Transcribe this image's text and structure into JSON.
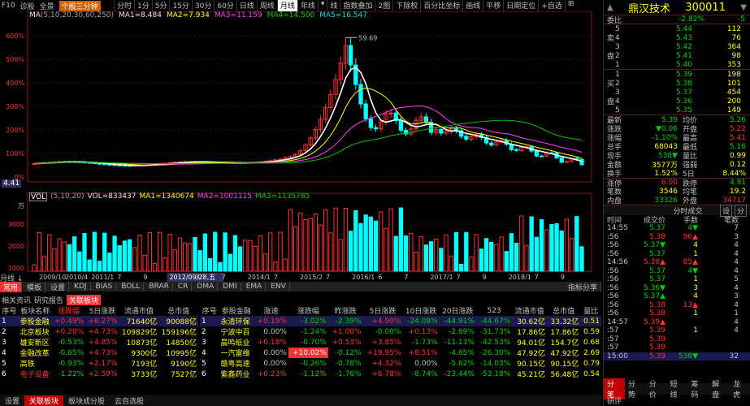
{
  "topbar": {
    "items": [
      "F10",
      "诊股",
      "全景",
      "个股三分钟"
    ],
    "active": "个股三分钟"
  },
  "toolbar": {
    "items": [
      "分时",
      "1分",
      "5分",
      "15分",
      "30分",
      "60分",
      "日线",
      "周线",
      "月线",
      "年线",
      "▾",
      "线",
      "指数叠加",
      "2图",
      "下除权",
      "百分比坐标",
      "画线",
      "平移",
      "日期定位",
      "+自选",
      "⊞"
    ],
    "active": "月线"
  },
  "ma_line": {
    "label": "MA",
    "params": "(5,10,20,30,60,250)",
    "ma1": "MA1=8.484",
    "ma2": "MA2=7.934",
    "ma3": "MA3=11.159",
    "ma4": "MA4=14.500",
    "ma5": "MA5=16.547"
  },
  "price_axis": [
    "600%",
    "500%",
    "400%",
    "300%",
    "200%",
    "100%",
    "0%"
  ],
  "peak_label": "59.69",
  "price_readout": "4.41",
  "vol_line": {
    "label": "VOL",
    "params": "(5,10,20)",
    "vol": "VOL=833437",
    "ma1": "MA1=1340674",
    "ma2": "MA2=1001115",
    "ma3": "MA3=1135785"
  },
  "vol_axis": [
    "3000",
    "2000",
    "1000"
  ],
  "vol_unit": "万",
  "time_axis": [
    "2009/10",
    "2010/4",
    "2011/1",
    "7",
    "9",
    "2012/09/28,五",
    "3/1",
    "7",
    "2014/1",
    "7",
    "2015/2",
    "7",
    "2016/1",
    "6",
    "7",
    "2017/1",
    "7",
    "9",
    "2018/1",
    "7",
    "9"
  ],
  "mode_label": "月线 ↓",
  "bottom_tabs": [
    "常用",
    "模板",
    "设置",
    "KDJ",
    "BIAS",
    "BOLL",
    "BRAR",
    "CR",
    "DMA",
    "DMI",
    "EMA",
    "ENV",
    "指标分享"
  ],
  "bottom_tabs_active": "常用",
  "low_tabs": [
    "相关资讯",
    "研究报告",
    "关联板块"
  ],
  "low_tabs_active": "关联板块",
  "sector_table": {
    "headers": [
      "序号",
      "板块名称",
      "涨跌幅",
      "5日涨跌",
      "流通市值",
      "总市值"
    ],
    "rows": [
      [
        "1",
        "参股金融",
        "+0.49%",
        "+6.27%",
        "71640亿",
        "90088亿"
      ],
      [
        "2",
        "北京板块",
        "+0.28%",
        "+4.73%",
        "109829亿",
        "159196亿"
      ],
      [
        "3",
        "雄安新区",
        "-0.53%",
        "+4.85%",
        "10873亿",
        "14850亿"
      ],
      [
        "4",
        "金融改革",
        "-0.65%",
        "+4.73%",
        "9300亿",
        "10995亿"
      ],
      [
        "5",
        "高铁",
        "-0.93%",
        "+2.17%",
        "7193亿",
        "9190亿"
      ],
      [
        "6",
        "电子设备",
        "-1.22%",
        "+2.59%",
        "3733亿",
        "7527亿"
      ]
    ]
  },
  "stock_table": {
    "headers": [
      "序号",
      "参股金融",
      "涨速",
      "涨跌幅",
      "昨涨跌",
      "5日涨跌",
      "10日涨跌",
      "20日涨跌",
      "523",
      "流通市值",
      "总市值",
      "量比"
    ],
    "rows": [
      [
        "1",
        "永清环保",
        "+0.19%",
        "-3.02%",
        "-2.39%",
        "+4.90%",
        "-24.08%",
        "-44.91%",
        "-44.67%",
        "30.62亿",
        "33.32亿",
        "0.51"
      ],
      [
        "2",
        "宁波中百",
        "0.00%",
        "-1.24%",
        "+1.00%",
        "-0.00%",
        "+0.13%",
        "-2.69%",
        "-31.73%",
        "17.86亿",
        "17.86亿",
        "0.59"
      ],
      [
        "3",
        "晨鸣纸业",
        "+0.18%",
        "-0.70%",
        "+0.53%",
        "+3.85%",
        "-1.73%",
        "-11.13%",
        "-42.53%",
        "94.01亿",
        "154.7亿",
        "0.68"
      ],
      [
        "4",
        "一汽富维",
        "0.00%",
        "+10.02%",
        "-0.12%",
        "+19.95%",
        "+8.51%",
        "-4.65%",
        "-26.30%",
        "47.92亿",
        "47.92亿",
        "2.69"
      ],
      [
        "5",
        "赣粤高速",
        "0.00%",
        "-0.26%",
        "-0.78%",
        "+4.32%",
        "0.00%",
        "-5.62%",
        "-14.03%",
        "90.15亿",
        "90.15亿",
        "0.79"
      ],
      [
        "6",
        "紫鑫药业",
        "+0.23%",
        "-1.12%",
        "-1.76%",
        "+6.78%",
        "-8.74%",
        "-23.44%",
        "-53.18%",
        "45.21亿",
        "56.48亿",
        "0.54"
      ]
    ]
  },
  "footer_tabs": [
    "设置",
    "关联板块",
    "板块成分股",
    "云自选股"
  ],
  "footer_active": "关联板块",
  "quote": {
    "name": "鼎汉技术",
    "code": "300011",
    "ratio_label": "委比",
    "ratio": "-2.82%",
    "ratio_vol": "-5",
    "sell_label": "卖盘",
    "buy_label": "买盘",
    "sell": [
      [
        "5",
        "5.44",
        "112"
      ],
      [
        "4",
        "5.43",
        "76"
      ],
      [
        "3",
        "5.42",
        "364"
      ],
      [
        "2",
        "5.41",
        "98"
      ],
      [
        "1",
        "5.40",
        "353"
      ]
    ],
    "buy": [
      [
        "1",
        "5.39",
        "198"
      ],
      [
        "2",
        "5.38",
        "101"
      ],
      [
        "3",
        "5.37",
        "454"
      ],
      [
        "4",
        "5.36",
        "200"
      ],
      [
        "5",
        "5.35",
        "149"
      ]
    ],
    "stats": [
      [
        "最新",
        "5.39",
        "均价",
        "5.26"
      ],
      [
        "涨跌",
        "▼0.06",
        "开盘",
        "5.22"
      ],
      [
        "涨幅",
        "-1.10%",
        "最高",
        "5.41"
      ],
      [
        "总手",
        "68043",
        "最低",
        "5.16"
      ],
      [
        "现手",
        "538▼",
        "量比",
        "0.99"
      ],
      [
        "金额",
        "3577万",
        "强弱",
        "0.12"
      ],
      [
        "换手",
        "1.52%",
        "5日",
        "8.44%"
      ],
      [
        "涨停",
        "6.00",
        "跌停",
        "4.91"
      ],
      [
        "笔数",
        "3546",
        "均笔",
        "19.2"
      ],
      [
        "内盘",
        "33326",
        "外盘",
        "34717"
      ]
    ],
    "tick_title": "分时成交",
    "tick_btns": [
      "设",
      "分"
    ],
    "tick_headers": [
      "时间",
      "成交价",
      "手数",
      "笔数"
    ],
    "ticks": [
      [
        "14:55",
        "5.37",
        "4▼",
        "7"
      ],
      [
        ":56",
        "5.38",
        "96▲",
        "3"
      ],
      [
        ":56",
        "5.37▼",
        "4",
        "4"
      ],
      [
        ":56",
        "5.37",
        "1",
        "4"
      ],
      [
        "14:56",
        "5.38▲",
        "85▲",
        "4"
      ],
      [
        ":56",
        "5.37",
        "4▼",
        "4"
      ],
      [
        ":56",
        "5.37",
        "1",
        "5"
      ],
      [
        ":56",
        "5.36▼",
        "3",
        "4"
      ],
      [
        ":56",
        "5.37▲",
        "4",
        "3"
      ],
      [
        ":56",
        "5.38",
        "13▲",
        "4"
      ],
      [
        ":56",
        "5.38",
        "1",
        "1"
      ],
      [
        "14:57",
        "5.39▲",
        "",
        "4"
      ],
      [
        ":57",
        "5.39",
        "1",
        "4"
      ],
      [
        ":57",
        "5.39",
        "",
        ""
      ],
      [
        ":57",
        "5.39",
        "",
        ""
      ],
      [
        "15:00",
        "5.39",
        "538▼",
        "32"
      ]
    ],
    "footer_tabs": [
      "分笔",
      "分势",
      "分价",
      "短线",
      "筹码",
      "解盘",
      "龙虎"
    ],
    "footer_active": "分笔",
    "last_label": "研评"
  },
  "colors": {
    "up": "#ff3030",
    "down": "#00ffff",
    "ma1": "#ffffff",
    "ma2": "#ffff00",
    "ma3": "#ff40ff",
    "ma4": "#00c000"
  }
}
